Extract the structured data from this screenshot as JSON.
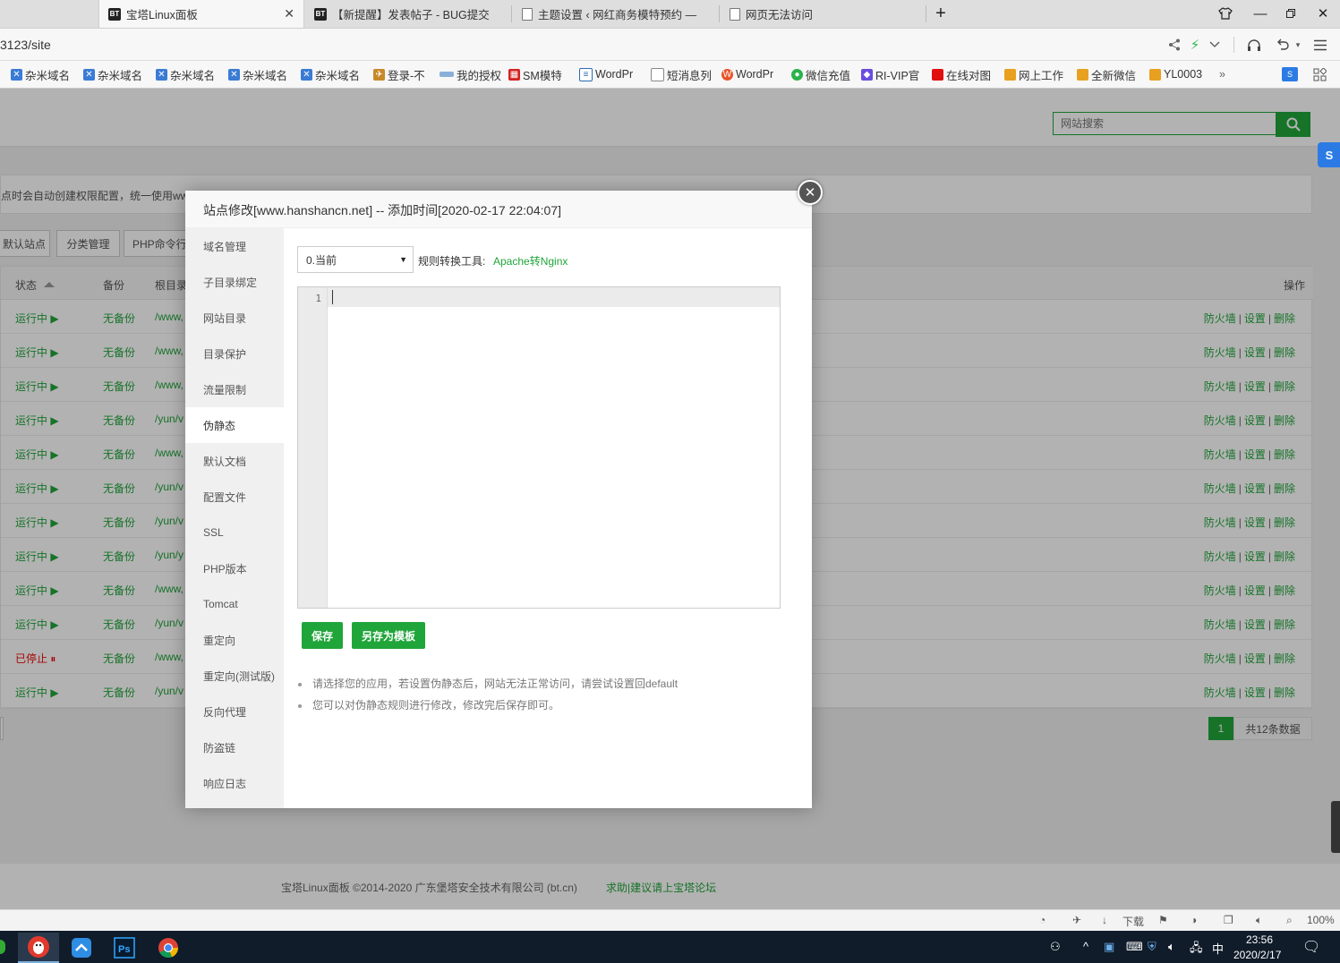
{
  "browser": {
    "tabs": [
      {
        "label": "宝塔Linux面板",
        "favicon": "BT",
        "active": true
      },
      {
        "label": "【新提醒】发表帖子 - BUG提交",
        "favicon": "BT",
        "active": false
      },
      {
        "label": "主题设置 ‹ 网红商务模特预约 —",
        "favicon": "",
        "active": false
      },
      {
        "label": "网页无法访问",
        "favicon": "",
        "active": false
      }
    ],
    "address": "3123/site",
    "bookmarks": [
      {
        "label": "杂米域名"
      },
      {
        "label": "杂米域名"
      },
      {
        "label": "杂米域名"
      },
      {
        "label": "杂米域名"
      },
      {
        "label": "杂米域名"
      },
      {
        "label": "登录-不"
      },
      {
        "label": "我的授权"
      },
      {
        "label": "SM模特"
      },
      {
        "label": "WordPr"
      },
      {
        "label": "短消息列"
      },
      {
        "label": "WordPr"
      },
      {
        "label": "微信充值"
      },
      {
        "label": "RI-VIP官"
      },
      {
        "label": "在线对图"
      },
      {
        "label": "网上工作"
      },
      {
        "label": "全新微信"
      },
      {
        "label": "YL0003"
      }
    ],
    "bookmarks_more": "»"
  },
  "panel": {
    "search_placeholder": "网站搜索",
    "notice": "点时会自动创建权限配置，统一使用ww",
    "buttons": {
      "default_site": "默认站点",
      "category": "分类管理",
      "php_cmd": "PHP命令行"
    },
    "table": {
      "headers": {
        "status": "状态",
        "backup": "备份",
        "root": "根目录",
        "ops": "操作"
      },
      "rows": [
        {
          "status": "运行中 ▶",
          "running": true,
          "backup": "无备份",
          "root": "/www,"
        },
        {
          "status": "运行中 ▶",
          "running": true,
          "backup": "无备份",
          "root": "/www,"
        },
        {
          "status": "运行中 ▶",
          "running": true,
          "backup": "无备份",
          "root": "/www,"
        },
        {
          "status": "运行中 ▶",
          "running": true,
          "backup": "无备份",
          "root": "/yun/v"
        },
        {
          "status": "运行中 ▶",
          "running": true,
          "backup": "无备份",
          "root": "/www,"
        },
        {
          "status": "运行中 ▶",
          "running": true,
          "backup": "无备份",
          "root": "/yun/v"
        },
        {
          "status": "运行中 ▶",
          "running": true,
          "backup": "无备份",
          "root": "/yun/v"
        },
        {
          "status": "运行中 ▶",
          "running": true,
          "backup": "无备份",
          "root": "/yun/y"
        },
        {
          "status": "运行中 ▶",
          "running": true,
          "backup": "无备份",
          "root": "/www,"
        },
        {
          "status": "运行中 ▶",
          "running": true,
          "backup": "无备份",
          "root": "/yun/v"
        },
        {
          "status": "已停止 ⏸",
          "running": false,
          "backup": "无备份",
          "root": "/www,"
        },
        {
          "status": "运行中 ▶",
          "running": true,
          "backup": "无备份",
          "root": "/yun/v"
        }
      ],
      "ops": {
        "firewall": "防火墙",
        "settings": "设置",
        "delete": "删除",
        "sep": "|"
      }
    },
    "pager": {
      "current": "1",
      "total": "共12条数据"
    },
    "footer": {
      "copyright": "宝塔Linux面板 ©2014-2020 广东堡塔安全技术有限公司 (bt.cn)",
      "link": "求助|建议请上宝塔论坛"
    }
  },
  "modal": {
    "title": "站点修改[www.hanshancn.net] -- 添加时间[2020-02-17 22:04:07]",
    "menu": [
      "域名管理",
      "子目录绑定",
      "网站目录",
      "目录保护",
      "流量限制",
      "伪静态",
      "默认文档",
      "配置文件",
      "SSL",
      "PHP版本",
      "Tomcat",
      "重定向",
      "重定向(测试版)",
      "反向代理",
      "防盗链",
      "响应日志"
    ],
    "active_menu": "伪静态",
    "select_value": "0.当前",
    "converter_label": "规则转换工具:",
    "converter_link": "Apache转Nginx",
    "line_number": "1",
    "save": "保存",
    "save_template": "另存为模板",
    "tips": [
      "请选择您的应用，若设置伪静态后，网站无法正常访问，请尝试设置回default",
      "您可以对伪静态规则进行修改，修改完后保存即可。"
    ]
  },
  "statusbar": {
    "download": "下载",
    "zoom": "100%"
  },
  "taskbar": {
    "time": "23:56",
    "date": "2020/2/17",
    "ime": "中"
  },
  "colors": {
    "accent": "#20a53a",
    "stopped": "#ef0808"
  }
}
